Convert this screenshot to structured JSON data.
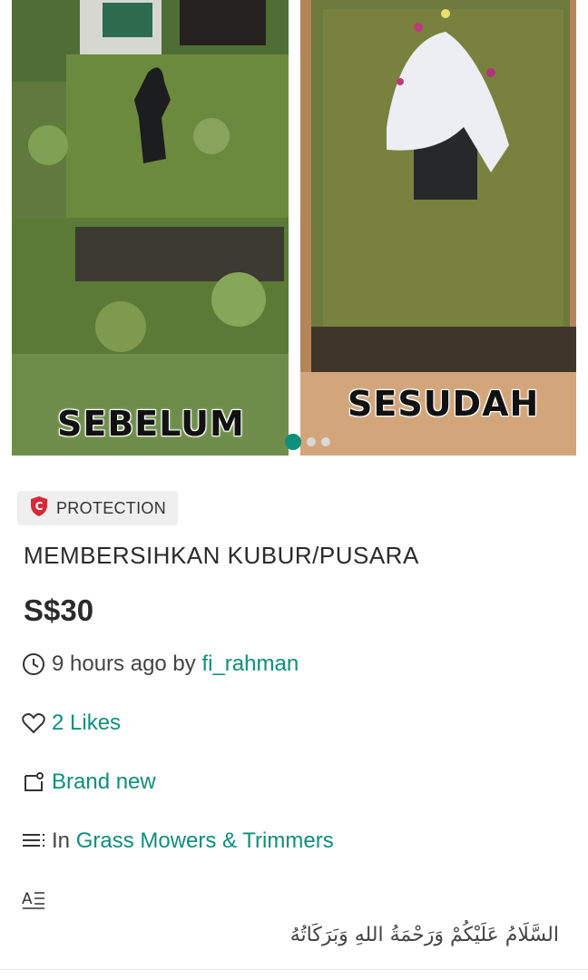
{
  "gallery": {
    "before_label": "SEBELUM",
    "after_label": "SESUDAH",
    "dots": [
      true,
      false,
      false
    ],
    "accent": "#0d8f7c"
  },
  "badge": {
    "icon": "shield-icon",
    "icon_letter": "C",
    "label": "PROTECTION"
  },
  "listing": {
    "title": "MEMBERSIHKAN KUBUR/PUSARA",
    "price": "S$30",
    "posted": "9 hours ago by ",
    "seller": "fi_rahman",
    "likes": "2 Likes",
    "condition": "Brand new",
    "category_prefix": "In ",
    "category": "Grass Mowers & Trimmers",
    "translate_icon": "translate-icon",
    "description_line": "السَّلَامُ عَلَيْكُمْ وَرَحْمَةُ اللهِ وَبَرَكَاتُهُ"
  }
}
